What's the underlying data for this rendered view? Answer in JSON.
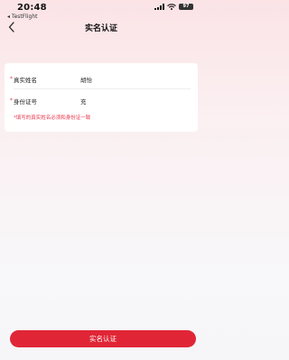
{
  "status_bar": {
    "time": "20:48",
    "back_app": "◂ TestFlight",
    "battery": "97"
  },
  "nav": {
    "title": "实名认证"
  },
  "form": {
    "required_mark": "*",
    "name_label": "真实姓名",
    "name_value": "胡怡",
    "id_label": "身份证号",
    "id_value": "充",
    "hint": "*填写的真实姓名必须和身份证一致"
  },
  "submit": {
    "label": "实名认证"
  },
  "colors": {
    "accent": "#e02636",
    "required": "#e8354a"
  }
}
